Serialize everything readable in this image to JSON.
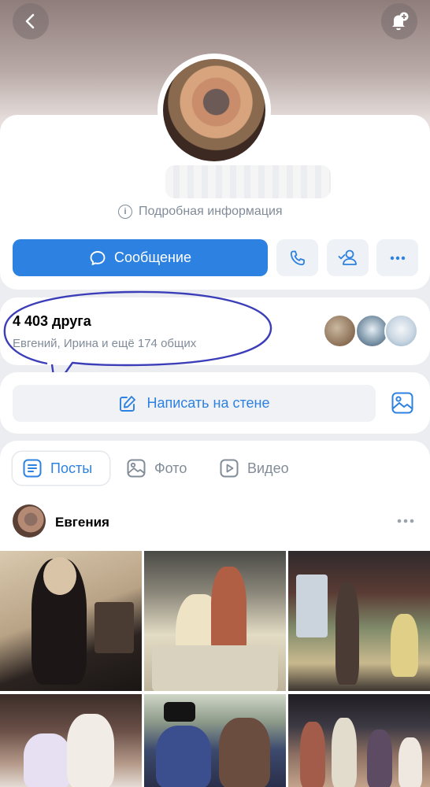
{
  "profile": {
    "info_label": "Подробная информация"
  },
  "actions": {
    "message_label": "Сообщение"
  },
  "friends": {
    "count_label": "4 403 друга",
    "mutual_label": "Евгений, Ирина и ещё 174 общих"
  },
  "wall": {
    "write_label": "Написать на стене"
  },
  "tabs": [
    {
      "label": "Посты",
      "active": true
    },
    {
      "label": "Фото",
      "active": false
    },
    {
      "label": "Видео",
      "active": false
    }
  ],
  "post": {
    "author": "Евгения"
  },
  "colors": {
    "accent": "#2d81e0",
    "secondary_text": "#818c99",
    "annotation": "#3b3eb8"
  },
  "icons": [
    "back-icon",
    "bell-plus-icon",
    "info-icon",
    "message-icon",
    "phone-icon",
    "friend-check-icon",
    "more-icon",
    "edit-icon",
    "image-icon",
    "posts-icon",
    "photo-icon",
    "video-icon"
  ]
}
